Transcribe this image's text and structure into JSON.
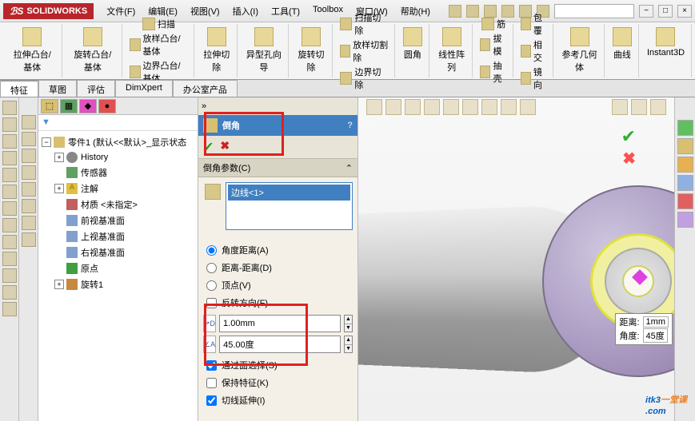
{
  "app_name": "SOLIDWORKS",
  "menu": {
    "file": "文件(F)",
    "edit": "编辑(E)",
    "view": "视图(V)",
    "insert": "插入(I)",
    "tools": "工具(T)",
    "toolbox": "Toolbox",
    "window": "窗口(W)",
    "help": "帮助(H)"
  },
  "ribbon": {
    "extrude": "拉伸凸台/基体",
    "revolve": "旋转凸台/基体",
    "sweep": "扫描",
    "loft_boss": "放样凸台/基体",
    "boundary_boss": "边界凸台/基体",
    "cut_extrude": "拉伸切除",
    "hole_wizard": "异型孔向导",
    "cut_revolve": "旋转切除",
    "cut_sweep": "扫描切除",
    "cut_loft": "放样切割除",
    "cut_boundary": "边界切除",
    "fillet": "圆角",
    "linear_pattern": "线性阵列",
    "rib": "筋",
    "draft": "拔模",
    "shell": "抽壳",
    "wrap": "包覆",
    "intersect": "相交",
    "mirror": "镜向",
    "ref_geom": "参考几何体",
    "curves": "曲线",
    "instant3d": "Instant3D"
  },
  "tabs": {
    "features": "特征",
    "sketch": "草图",
    "evaluate": "评估",
    "dimxpert": "DimXpert",
    "office": "办公室产品"
  },
  "tree": {
    "part": "零件1  (默认<<默认>_显示状态",
    "history": "History",
    "sensors": "传感器",
    "annotations": "注解",
    "material": "材质 <未指定>",
    "front_plane": "前视基准面",
    "top_plane": "上视基准面",
    "right_plane": "右视基准面",
    "origin": "原点",
    "revolve1": "旋转1"
  },
  "pm": {
    "title": "倒角",
    "params_header": "倒角参数(C)",
    "selection_item": "边线<1>",
    "opt_angle_distance": "角度距离(A)",
    "opt_distance_distance": "距离-距离(D)",
    "opt_vertex": "顶点(V)",
    "opt_flip": "反转方向(F)",
    "distance_value": "1.00mm",
    "angle_value": "45.00度",
    "through_face_select": "通过面选择(S)",
    "keep_features": "保持特征(K)",
    "tangent_prop": "切线延伸(I)"
  },
  "dimension": {
    "distance_label": "距离:",
    "distance_value": "1mm",
    "angle_label": "角度:",
    "angle_value": "45度"
  },
  "watermark": {
    "text": "itk3",
    "sub": "一堂课",
    "dotcom": ".com"
  }
}
